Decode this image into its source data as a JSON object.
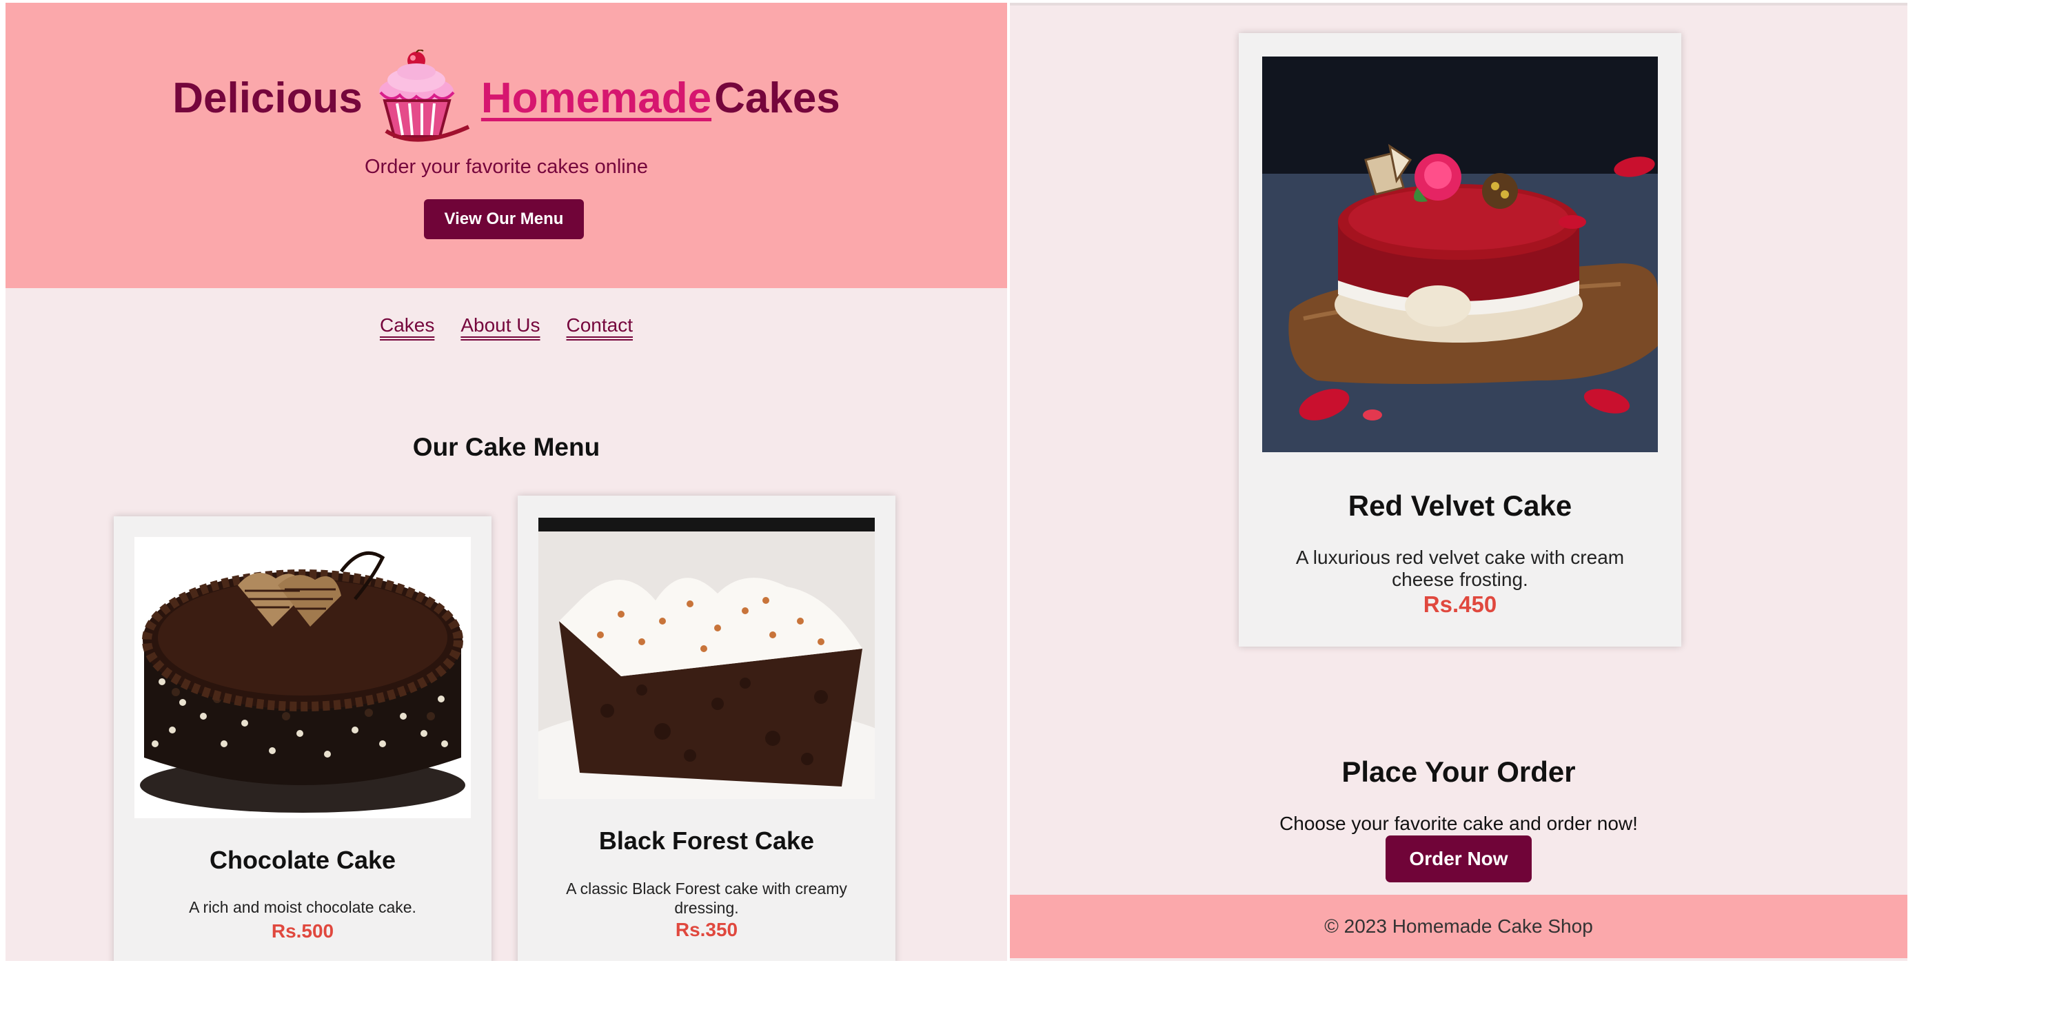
{
  "hero": {
    "title_before": "Delicious",
    "title_link": "Homemade",
    "title_after": "Cakes",
    "subtitle": "Order your favorite cakes online",
    "button_label": "View Our Menu"
  },
  "nav": {
    "items": [
      {
        "label": "Cakes"
      },
      {
        "label": "About Us"
      },
      {
        "label": "Contact"
      }
    ]
  },
  "menu": {
    "title": "Our Cake Menu",
    "cakes": [
      {
        "name": "Chocolate Cake",
        "description": "A rich and moist chocolate cake.",
        "price": "Rs.500"
      },
      {
        "name": "Black Forest Cake",
        "description": "A classic Black Forest cake with creamy dressing.",
        "price": "Rs.350"
      },
      {
        "name": "Red Velvet Cake",
        "description": "A luxurious red velvet cake with cream cheese frosting.",
        "price": "Rs.450"
      }
    ]
  },
  "order": {
    "title": "Place Your Order",
    "subtitle": "Choose your favorite cake and order now!",
    "button_label": "Order Now"
  },
  "footer": {
    "text": "© 2023 Homemade Cake Shop"
  },
  "colors": {
    "hero_bg": "#fba8ab",
    "page_bg": "#f6e9eb",
    "brand_dark": "#700438",
    "link_pink": "#d6166f",
    "price_red": "#e0483e",
    "card_bg": "#f2f1f1"
  },
  "icons": {
    "logo": "cupcake-icon"
  }
}
